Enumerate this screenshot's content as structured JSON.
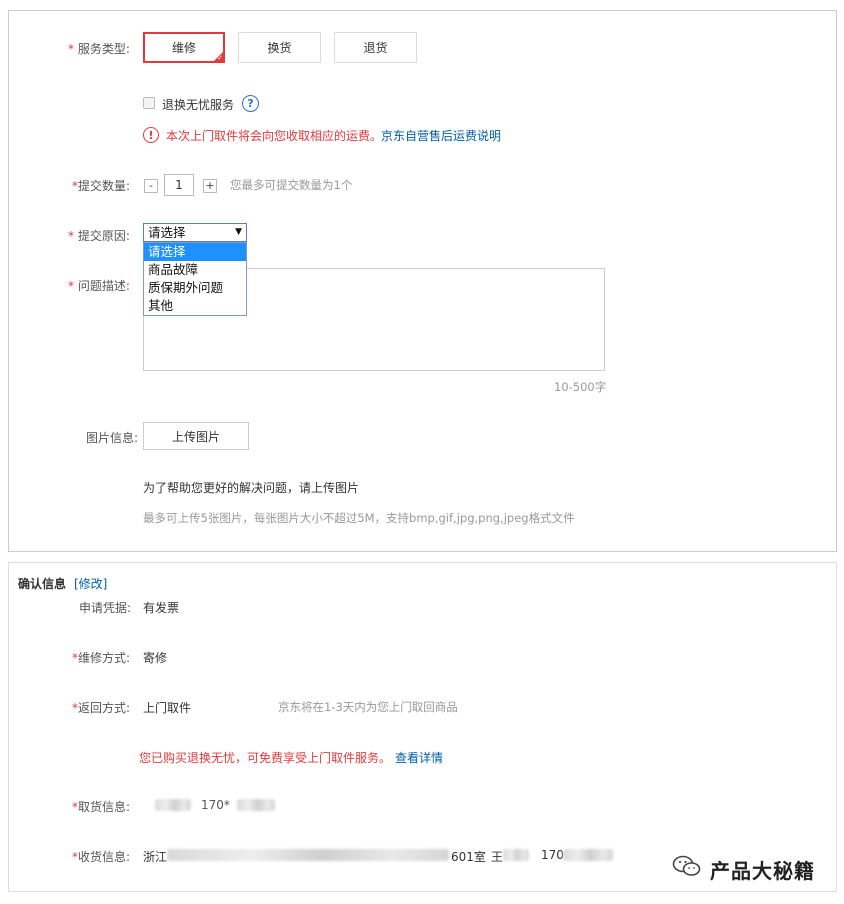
{
  "form": {
    "service_type": {
      "required_mark": "*",
      "label": "服务类型:",
      "options": [
        "维修",
        "换货",
        "退货"
      ]
    },
    "worry_free": {
      "label": "退换无忧服务"
    },
    "notice": {
      "text": "本次上门取件将会向您收取相应的运费。",
      "link": "京东自营售后运费说明"
    },
    "quantity": {
      "required_mark": "*",
      "label": "提交数量:",
      "minus": "-",
      "value": "1",
      "plus": "+",
      "hint": "您最多可提交数量为1个"
    },
    "reason": {
      "required_mark": "*",
      "label": "提交原因:",
      "selected": "请选择",
      "options": [
        "请选择",
        "商品故障",
        "质保期外问题",
        "其他"
      ]
    },
    "description": {
      "required_mark": "*",
      "label": "问题描述:",
      "counter": "10-500字"
    },
    "images": {
      "label": "图片信息:",
      "upload_label": "上传图片",
      "hint1": "为了帮助您更好的解决问题，请上传图片",
      "hint2": "最多可上传5张图片，每张图片大小不超过5M，支持bmp,gif,jpg,png,jpeg格式文件"
    }
  },
  "confirm": {
    "title": "确认信息",
    "edit_link": "[修改]",
    "voucher": {
      "label": "申请凭据:",
      "value": "有发票"
    },
    "repair_method": {
      "required_mark": "*",
      "label": "维修方式:",
      "value": "寄修"
    },
    "return_method": {
      "required_mark": "*",
      "label": "返回方式:",
      "value": "上门取件",
      "note": "京东将在1-3天内为您上门取回商品"
    },
    "promo": {
      "text": "您已购买退换无忧，可免费享受上门取件服务。",
      "link": "查看详情"
    },
    "pickup": {
      "required_mark": "*",
      "label": "取货信息:",
      "value": "170*"
    },
    "delivery": {
      "required_mark": "*",
      "label": "收货信息:",
      "prefix": "浙江",
      "room": "601室",
      "name_prefix": "王",
      "phone": "170"
    }
  },
  "watermark": {
    "text": "产品大秘籍"
  },
  "colors": {
    "accent_red": "#e4393c",
    "link_blue": "#005ea7",
    "dropdown_highlight": "#1e90ff"
  }
}
